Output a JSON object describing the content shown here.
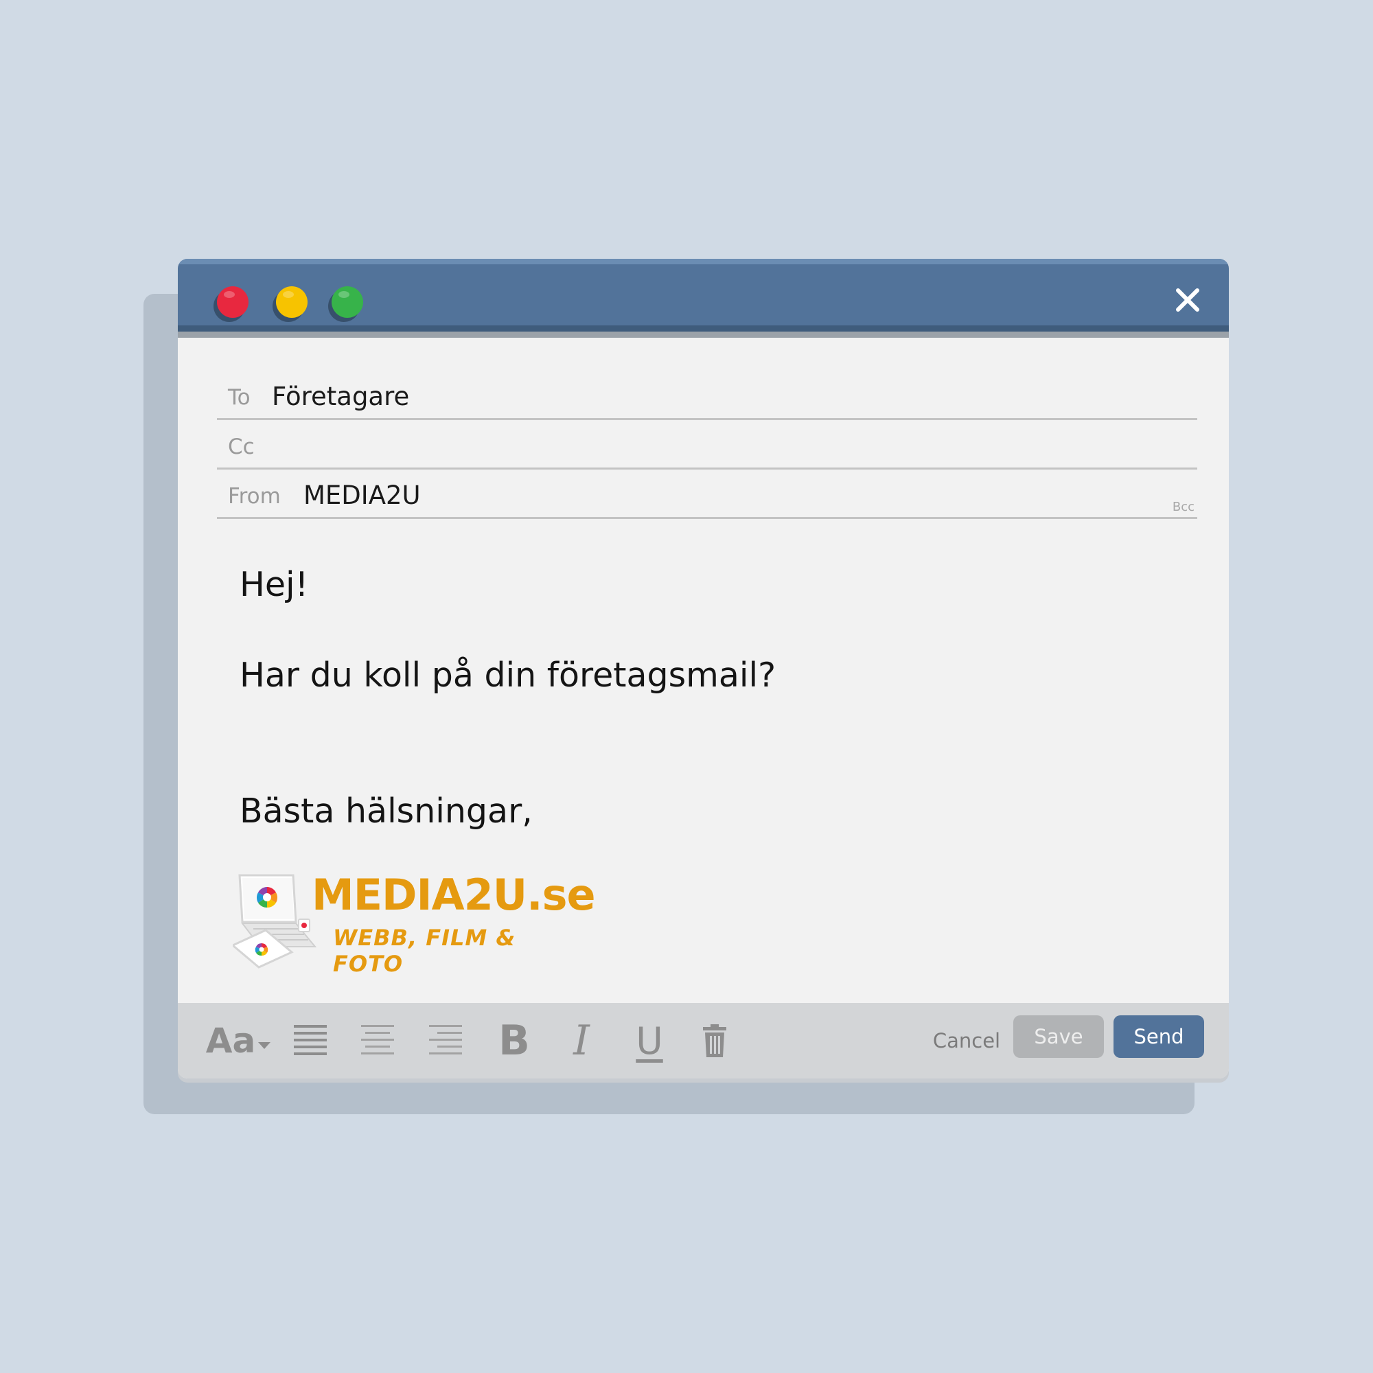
{
  "window": {
    "controls": {
      "close_color": "#e8283f",
      "minimize_color": "#f7c300",
      "maximize_color": "#37b34a",
      "close_icon": "close-icon"
    },
    "titlebar_color": "#52739a"
  },
  "header": {
    "to_label": "To",
    "to_value": "Företagare",
    "cc_label": "Cc",
    "cc_value": "",
    "from_label": "From",
    "from_value": "MEDIA2U",
    "bcc_label": "Bcc"
  },
  "message": {
    "greeting": "Hej!",
    "question": "Har du koll på din företagsmail?",
    "closing": "Bästa hälsningar,"
  },
  "signature": {
    "name": "MEDIA2U.se",
    "tagline": "WEBB, FILM & FOTO",
    "color": "#e59a10"
  },
  "toolbar": {
    "font_label": "Aa",
    "bold_label": "B",
    "italic_label": "I",
    "underline_label": "U",
    "icons": [
      "font-size-icon",
      "align-left-icon",
      "align-center-icon",
      "align-right-icon",
      "bold-icon",
      "italic-icon",
      "underline-icon",
      "trash-icon"
    ],
    "cancel_label": "Cancel",
    "save_label": "Save",
    "send_label": "Send",
    "send_color": "#52739a"
  }
}
